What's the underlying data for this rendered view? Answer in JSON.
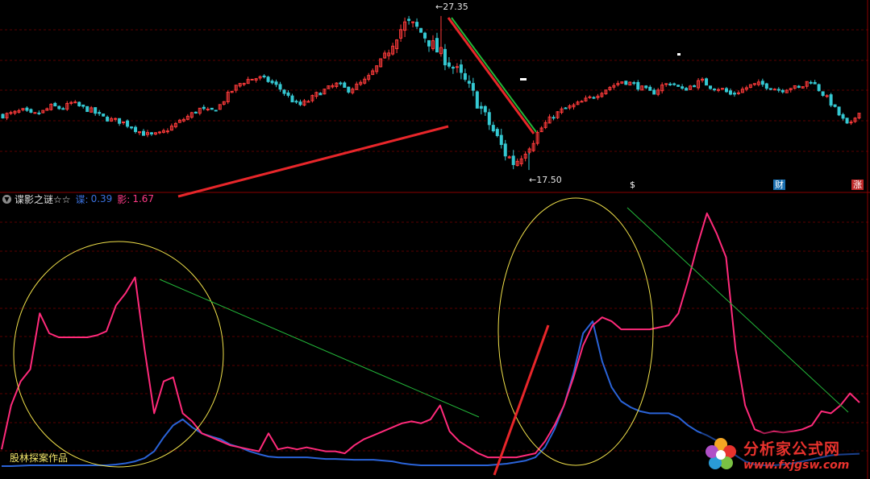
{
  "indicator": {
    "toggle_icon": "chevron-down-icon",
    "name": "谍影之谜☆☆",
    "series1_label": "谍:",
    "series1_value": "0.39",
    "series2_label": "影:",
    "series2_value": "1.67",
    "credit": "股林探案作品"
  },
  "price_annotations": {
    "high_label": "27.35",
    "low_label": "17.50"
  },
  "event_badges": [
    {
      "text": "$",
      "color": "#e03030",
      "bg": "transparent"
    },
    {
      "text": "财",
      "color": "#ffffff",
      "bg": "#1a6fb0"
    },
    {
      "text": "涨",
      "color": "#ffffff",
      "bg": "#c02a2a"
    }
  ],
  "watermark": {
    "title": "分析家公式网",
    "url": "www.fxjgsw.com"
  },
  "colors": {
    "up": "#ff3b3b",
    "down": "#35c8d2",
    "grid": "#5a0000",
    "divider": "#8a0000",
    "series1": "#2a63d8",
    "series2": "#ff2a7a",
    "annotation_circle": "#f0e04a",
    "trend_green": "#23b83a",
    "trend_red": "#e8262a"
  },
  "chart_data": [
    {
      "type": "candlestick",
      "title": "",
      "price_high": 27.35,
      "price_low": 17.5,
      "close_path": [
        21.0,
        21.1,
        21.3,
        21.0,
        21.2,
        21.6,
        21.4,
        21.8,
        21.5,
        21.3,
        20.9,
        20.7,
        20.6,
        20.3,
        19.9,
        19.7,
        19.8,
        20.2,
        20.6,
        21.0,
        21.4,
        21.2,
        21.6,
        22.4,
        23.0,
        23.3,
        23.4,
        23.2,
        22.8,
        22.2,
        21.6,
        21.9,
        22.4,
        22.7,
        23.0,
        22.6,
        22.9,
        23.3,
        24.1,
        25.0,
        26.2,
        26.9,
        26.6,
        26.0,
        25.2,
        24.6,
        23.9,
        23.1,
        22.1,
        20.9,
        19.8,
        18.6,
        17.9,
        18.8,
        19.6,
        20.4,
        21.0,
        21.4,
        21.6,
        21.9,
        22.2,
        22.6,
        22.9,
        23.2,
        23.0,
        22.7,
        22.4,
        22.9,
        23.1,
        22.6,
        22.9,
        23.2,
        22.8,
        22.7,
        22.3,
        22.6,
        22.9,
        23.0,
        22.8,
        22.6,
        22.8,
        22.7,
        23.3,
        22.6,
        21.9,
        21.0,
        20.2,
        21.3
      ]
    },
    {
      "type": "line",
      "title": "谍影之谜☆☆",
      "series": [
        {
          "name": "谍",
          "last": 0.39,
          "values": [
            0.08,
            0.08,
            0.09,
            0.1,
            0.1,
            0.1,
            0.1,
            0.1,
            0.1,
            0.1,
            0.1,
            0.1,
            0.12,
            0.15,
            0.2,
            0.28,
            0.45,
            0.8,
            1.1,
            1.25,
            1.05,
            0.9,
            0.82,
            0.75,
            0.62,
            0.55,
            0.45,
            0.38,
            0.32,
            0.3,
            0.3,
            0.3,
            0.3,
            0.28,
            0.26,
            0.26,
            0.25,
            0.24,
            0.24,
            0.24,
            0.22,
            0.2,
            0.15,
            0.12,
            0.1,
            0.1,
            0.1,
            0.1,
            0.1,
            0.1,
            0.1,
            0.1,
            0.12,
            0.14,
            0.18,
            0.22,
            0.3,
            0.55,
            1.0,
            1.6,
            2.4,
            3.4,
            3.7,
            2.7,
            2.05,
            1.7,
            1.55,
            1.45,
            1.4,
            1.4,
            1.4,
            1.3,
            1.1,
            0.95,
            0.85,
            0.72,
            0.55,
            0.35,
            0.2,
            0.12,
            0.1,
            0.1,
            0.12,
            0.15,
            0.2,
            0.25,
            0.3,
            0.35,
            0.37,
            0.38,
            0.39
          ]
        },
        {
          "name": "影",
          "last": 1.67,
          "values": [
            0.5,
            1.6,
            2.2,
            2.5,
            3.9,
            3.4,
            3.3,
            3.3,
            3.3,
            3.3,
            3.35,
            3.45,
            4.1,
            4.4,
            4.8,
            3.0,
            1.4,
            2.2,
            2.3,
            1.4,
            1.2,
            0.9,
            0.8,
            0.7,
            0.6,
            0.55,
            0.5,
            0.45,
            0.9,
            0.5,
            0.55,
            0.5,
            0.55,
            0.5,
            0.45,
            0.45,
            0.4,
            0.6,
            0.75,
            0.85,
            0.95,
            1.05,
            1.15,
            1.2,
            1.15,
            1.25,
            1.6,
            0.95,
            0.7,
            0.55,
            0.4,
            0.3,
            0.3,
            0.3,
            0.3,
            0.35,
            0.4,
            0.7,
            1.1,
            1.6,
            2.3,
            3.1,
            3.6,
            3.8,
            3.7,
            3.5,
            3.5,
            3.5,
            3.5,
            3.55,
            3.6,
            3.9,
            4.7,
            5.6,
            6.4,
            5.9,
            5.3,
            3.0,
            1.6,
            1.0,
            0.9,
            0.95,
            0.92,
            0.95,
            1.0,
            1.1,
            1.45,
            1.4,
            1.6,
            1.9,
            1.67
          ]
        }
      ]
    }
  ]
}
